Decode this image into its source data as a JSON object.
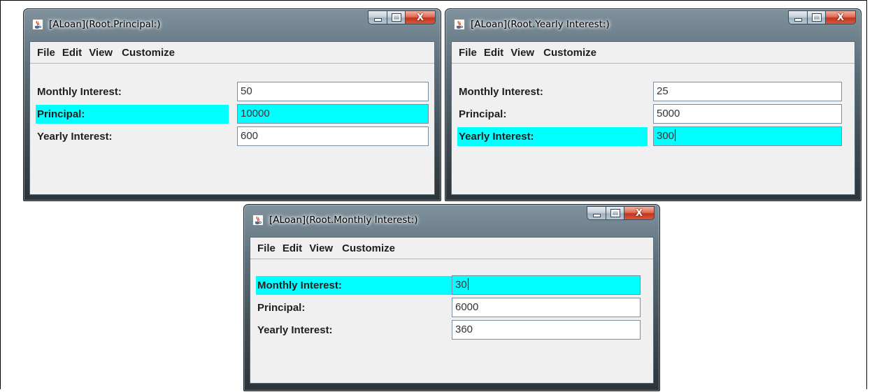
{
  "menu": [
    "File",
    "Edit",
    "View",
    "Customize"
  ],
  "windows": [
    {
      "title": "[ALoan](Root.Principal:)",
      "rows": [
        {
          "label": "Monthly Interest:",
          "value": "50"
        },
        {
          "label": "Principal:",
          "value": "10000"
        },
        {
          "label": "Yearly Interest:",
          "value": "600"
        }
      ]
    },
    {
      "title": "[ALoan](Root.Yearly Interest:)",
      "rows": [
        {
          "label": "Monthly Interest:",
          "value": "25"
        },
        {
          "label": "Principal:",
          "value": "5000"
        },
        {
          "label": "Yearly Interest:",
          "value": "300"
        }
      ]
    },
    {
      "title": "[ALoan](Root.Monthly Interest:)",
      "rows": [
        {
          "label": "Monthly Interest:",
          "value": "30"
        },
        {
          "label": "Principal:",
          "value": "6000"
        },
        {
          "label": "Yearly Interest:",
          "value": "360"
        }
      ]
    }
  ],
  "colors": {
    "selected_row": "#00ffff",
    "client_bg": "#f0f0f0"
  },
  "icons": {
    "app": "java-coffee-cup-icon",
    "minimize": "minimize-icon",
    "maximize": "maximize-icon",
    "close": "close-icon"
  }
}
